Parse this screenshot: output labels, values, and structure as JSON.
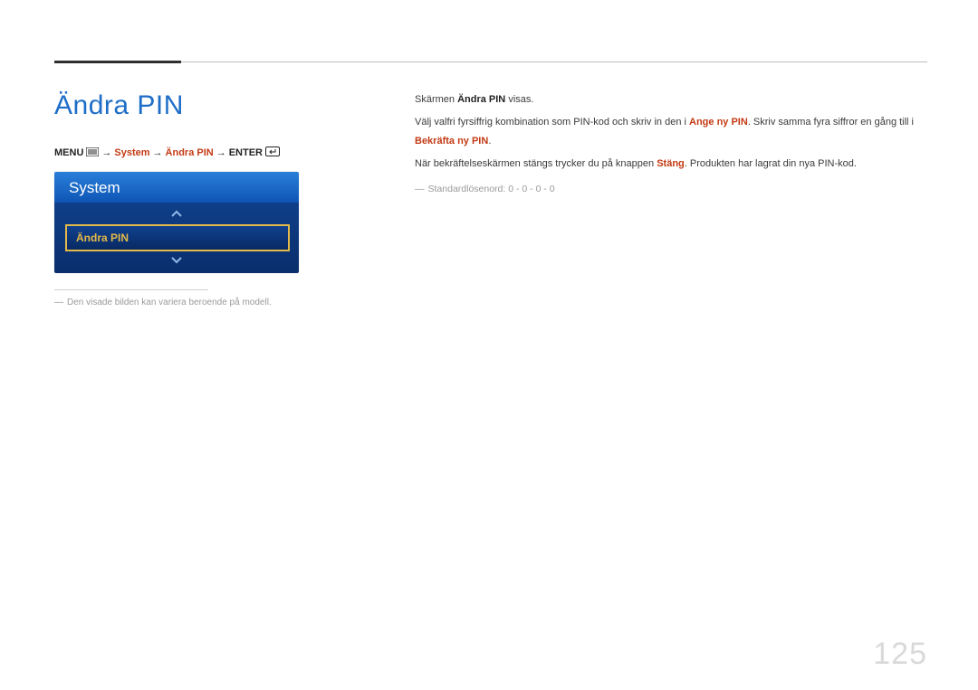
{
  "page_number": "125",
  "title": "Ändra PIN",
  "breadcrumb": {
    "menu_label": "MENU",
    "arrow": "→",
    "nav1": "System",
    "nav2": "Ändra PIN",
    "enter_label": "ENTER"
  },
  "osd": {
    "header": "System",
    "selected_item": "Ändra PIN"
  },
  "left_footnote": "Den visade bilden kan variera beroende på modell.",
  "right": {
    "line1_a": "Skärmen ",
    "line1_b": "Ändra PIN",
    "line1_c": " visas.",
    "line2_a": "Välj valfri fyrsiffrig kombination som PIN-kod och skriv in den i ",
    "line2_b": "Ange ny PIN",
    "line2_c": ". Skriv samma fyra siffror en gång till i ",
    "line2_d": "Bekräfta ny PIN",
    "line2_e": ".",
    "line3_a": "När bekräftelseskärmen stängs trycker du på knappen ",
    "line3_b": "Stäng",
    "line3_c": ". Produkten har lagrat din nya PIN-kod.",
    "subnote": "Standardlösenord: 0 - 0 - 0 - 0"
  }
}
